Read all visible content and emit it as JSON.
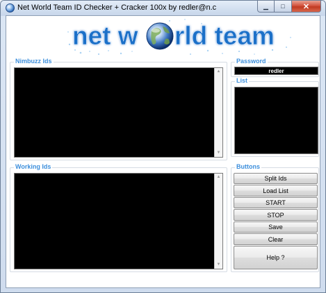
{
  "window": {
    "title": "Net World Team ID Checker + Cracker 100x by redler@n.c",
    "minimize_glyph": "▁",
    "maximize_glyph": "□",
    "close_glyph": "✕"
  },
  "logo": {
    "text_before": "net w",
    "text_after": "rld team",
    "globe_icon": "globe-icon"
  },
  "groups": {
    "nimbuzz_ids": {
      "label": "Nimbuzz Ids"
    },
    "working_ids": {
      "label": "Working Ids"
    },
    "password": {
      "label": "Password",
      "value": "redler"
    },
    "list": {
      "label": "List"
    },
    "buttons": {
      "label": "Buttons"
    }
  },
  "scrollbar": {
    "up_glyph": "▲",
    "down_glyph": "▼"
  },
  "buttons": [
    {
      "label": "Split Ids"
    },
    {
      "label": "Load List"
    },
    {
      "label": "START"
    },
    {
      "label": "STOP"
    },
    {
      "label": "Save"
    },
    {
      "label": "Clear"
    },
    {
      "label": "Help ?"
    }
  ],
  "colors": {
    "group_label": "#3d8fdc",
    "logo_blue": "#1f70c8",
    "text_area_bg": "#000000",
    "close_button": "#c8442c"
  }
}
